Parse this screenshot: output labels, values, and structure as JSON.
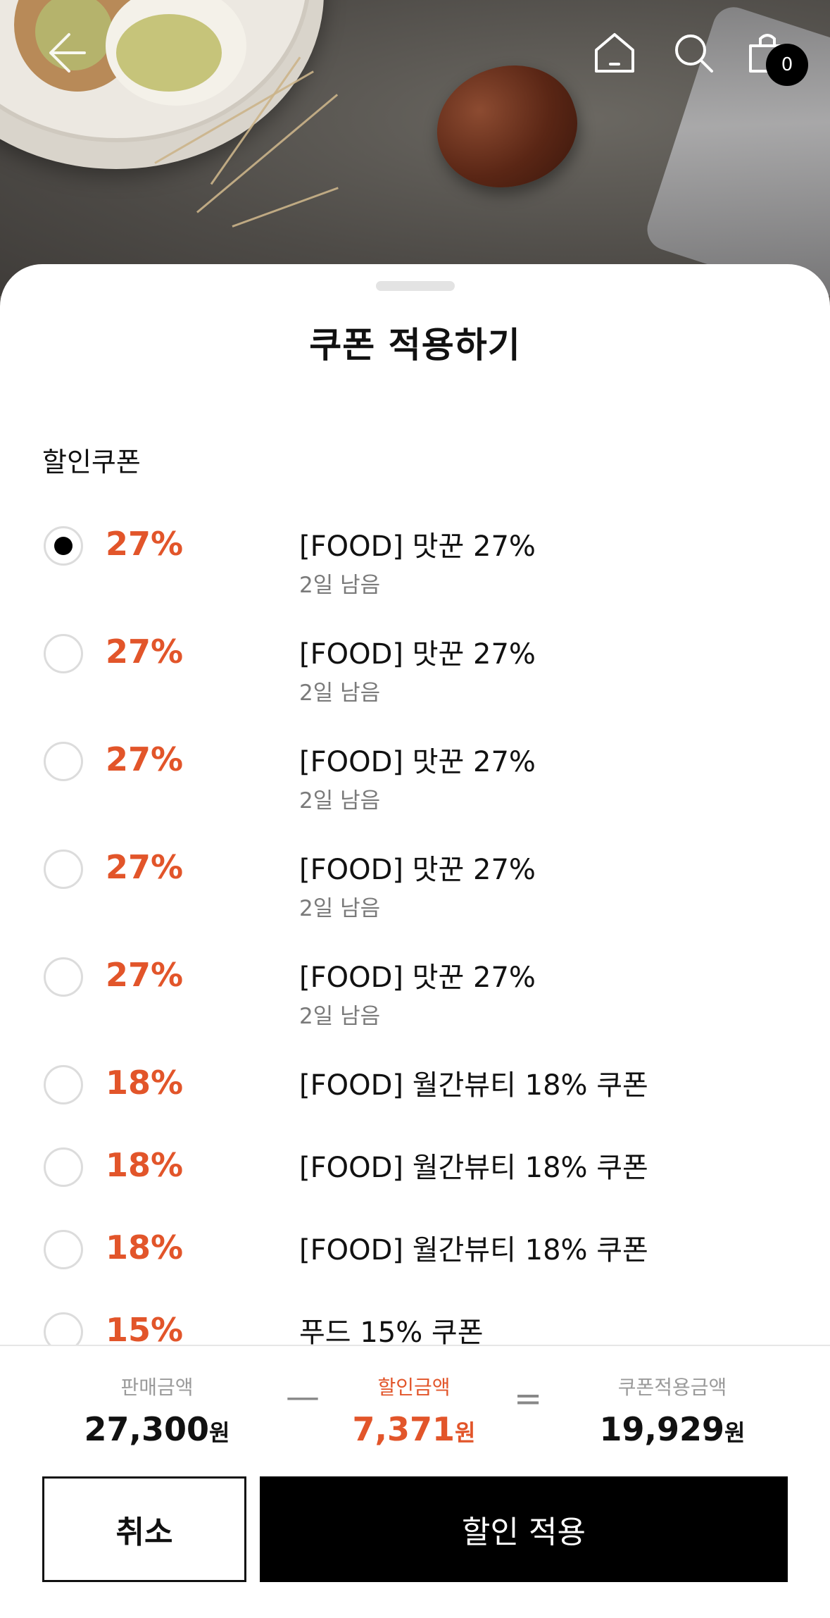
{
  "header": {
    "cart_count": "0",
    "icons": [
      "back-arrow-icon",
      "home-icon",
      "search-icon",
      "shopping-bag-icon"
    ]
  },
  "sheet": {
    "title": "쿠폰 적용하기",
    "section_label": "할인쿠폰"
  },
  "coupons": [
    {
      "percent": "27%",
      "name": "[FOOD] 맛꾼 27%",
      "remaining": "2일 남음",
      "selected": true
    },
    {
      "percent": "27%",
      "name": "[FOOD] 맛꾼 27%",
      "remaining": "2일 남음",
      "selected": false
    },
    {
      "percent": "27%",
      "name": "[FOOD] 맛꾼 27%",
      "remaining": "2일 남음",
      "selected": false
    },
    {
      "percent": "27%",
      "name": "[FOOD] 맛꾼 27%",
      "remaining": "2일 남음",
      "selected": false
    },
    {
      "percent": "27%",
      "name": "[FOOD] 맛꾼 27%",
      "remaining": "2일 남음",
      "selected": false
    },
    {
      "percent": "18%",
      "name": "[FOOD] 월간뷰티 18% 쿠폰",
      "remaining": "",
      "selected": false
    },
    {
      "percent": "18%",
      "name": "[FOOD] 월간뷰티 18% 쿠폰",
      "remaining": "",
      "selected": false
    },
    {
      "percent": "18%",
      "name": "[FOOD] 월간뷰티 18% 쿠폰",
      "remaining": "",
      "selected": false
    },
    {
      "percent": "15%",
      "name": "푸드 15% 쿠폰",
      "remaining": "",
      "selected": false
    }
  ],
  "summary": {
    "sale_label": "판매금액",
    "sale_value": "27,300",
    "discount_label": "할인금액",
    "discount_value": "7,371",
    "result_label": "쿠폰적용금액",
    "result_value": "19,929",
    "unit": "원",
    "minus": "—",
    "equals": "="
  },
  "buttons": {
    "cancel": "취소",
    "apply": "할인 적용"
  },
  "colors": {
    "accent": "#e2552a",
    "primary_button": "#000000"
  }
}
